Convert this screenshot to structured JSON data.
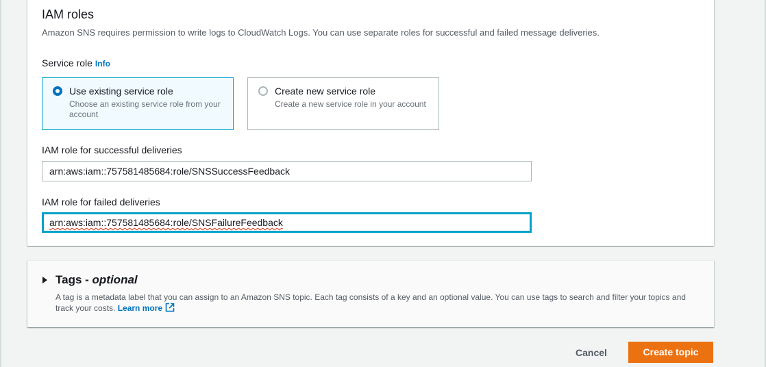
{
  "iam_roles": {
    "title": "IAM roles",
    "description": "Amazon SNS requires permission to write logs to CloudWatch Logs. You can use separate roles for successful and failed message deliveries.",
    "service_role_label": "Service role",
    "info_link": "Info",
    "options": [
      {
        "title": "Use existing service role",
        "description": "Choose an existing service role from your account",
        "selected": true
      },
      {
        "title": "Create new service role",
        "description": "Create a new service role in your account",
        "selected": false
      }
    ],
    "success_label": "IAM role for successful deliveries",
    "success_value": "arn:aws:iam::757581485684:role/SNSSuccessFeedback",
    "failure_label": "IAM role for failed deliveries",
    "failure_value_prefix": "arn:aws:iam::757581485684:role/",
    "failure_value_suffix": "SNSFailureFeedback"
  },
  "tags": {
    "title": "Tags - ",
    "title_optional": "optional",
    "description": "A tag is a metadata label that you can assign to an Amazon SNS topic. Each tag consists of a key and an optional value. You can use tags to search and filter your topics and track your costs.",
    "learn_more": "Learn more"
  },
  "actions": {
    "cancel": "Cancel",
    "create": "Create topic"
  },
  "colors": {
    "accent_blue": "#0073bb",
    "focus_cyan": "#00a1c9",
    "primary_orange": "#ec7211"
  },
  "icons": {
    "external_link": "external-link-icon",
    "caret": "caret-right-icon"
  }
}
